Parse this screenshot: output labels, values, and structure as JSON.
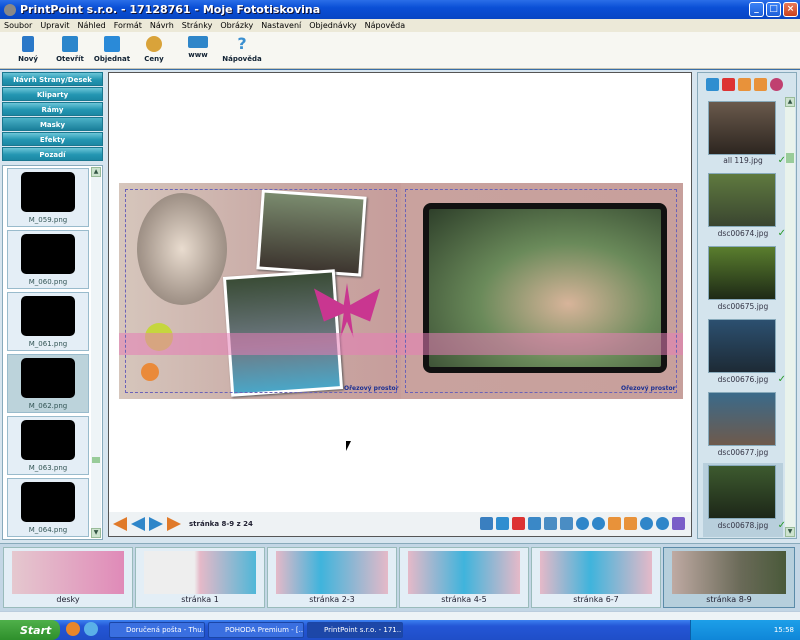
{
  "window": {
    "title": "PrintPoint s.r.o. - 17128761 - Moje Fototiskovina"
  },
  "menu": [
    "Soubor",
    "Upravit",
    "Náhled",
    "Formát",
    "Návrh",
    "Stránky",
    "Obrázky",
    "Nastavení",
    "Objednávky",
    "Nápověda"
  ],
  "toolbar": [
    {
      "label": "Nový",
      "icon": "new-icon",
      "color": "#2a78c8"
    },
    {
      "label": "Otevřít",
      "icon": "open-book-icon",
      "color": "#2b86cc"
    },
    {
      "label": "Objednat",
      "icon": "cart-icon",
      "color": "#2a8ad8"
    },
    {
      "label": "Ceny",
      "icon": "coins-icon",
      "color": "#d9a33a"
    },
    {
      "label": "www",
      "icon": "web-icon",
      "color": "#2f86c9"
    },
    {
      "label": "Nápověda",
      "icon": "help-icon",
      "color": "#3a8fd0"
    }
  ],
  "categories": [
    "Návrh Strany/Desek",
    "Kliparty",
    "Rámy",
    "Masky",
    "Efekty",
    "Pozadí"
  ],
  "active_category": "Masky",
  "masks": [
    "M_059.png",
    "M_060.png",
    "M_061.png",
    "M_062.png",
    "M_063.png",
    "M_064.png"
  ],
  "selected_mask": "M_062.png",
  "canvas": {
    "crop_label_left": "Ořezový prostor",
    "crop_label_right": "Ořezový prostor",
    "page_info": "stránka 8-9 z 24"
  },
  "photos": [
    {
      "name": "all 119.jpg",
      "checked": true
    },
    {
      "name": "dsc00674.jpg",
      "checked": true
    },
    {
      "name": "dsc00675.jpg",
      "checked": false
    },
    {
      "name": "dsc00676.jpg",
      "checked": true
    },
    {
      "name": "dsc00677.jpg",
      "checked": false
    },
    {
      "name": "dsc00678.jpg",
      "checked": true
    }
  ],
  "thumbnails": [
    "desky",
    "stránka 1",
    "stránka 2-3",
    "stránka 4-5",
    "stránka 6-7",
    "stránka 8-9"
  ],
  "selected_thumbnail": "stránka 8-9",
  "taskbar": {
    "start": "Start",
    "items": [
      "Doručená pošta - Thu...",
      "POHODA Premium - [...",
      "PrintPoint s.r.o. - 171..."
    ],
    "clock": "15:58"
  },
  "colors": {
    "title_blue": "#0a4fd6",
    "panel_teal": "#2496b2",
    "pink_band": "#e57eb6",
    "crop_text": "#1a2f92"
  }
}
